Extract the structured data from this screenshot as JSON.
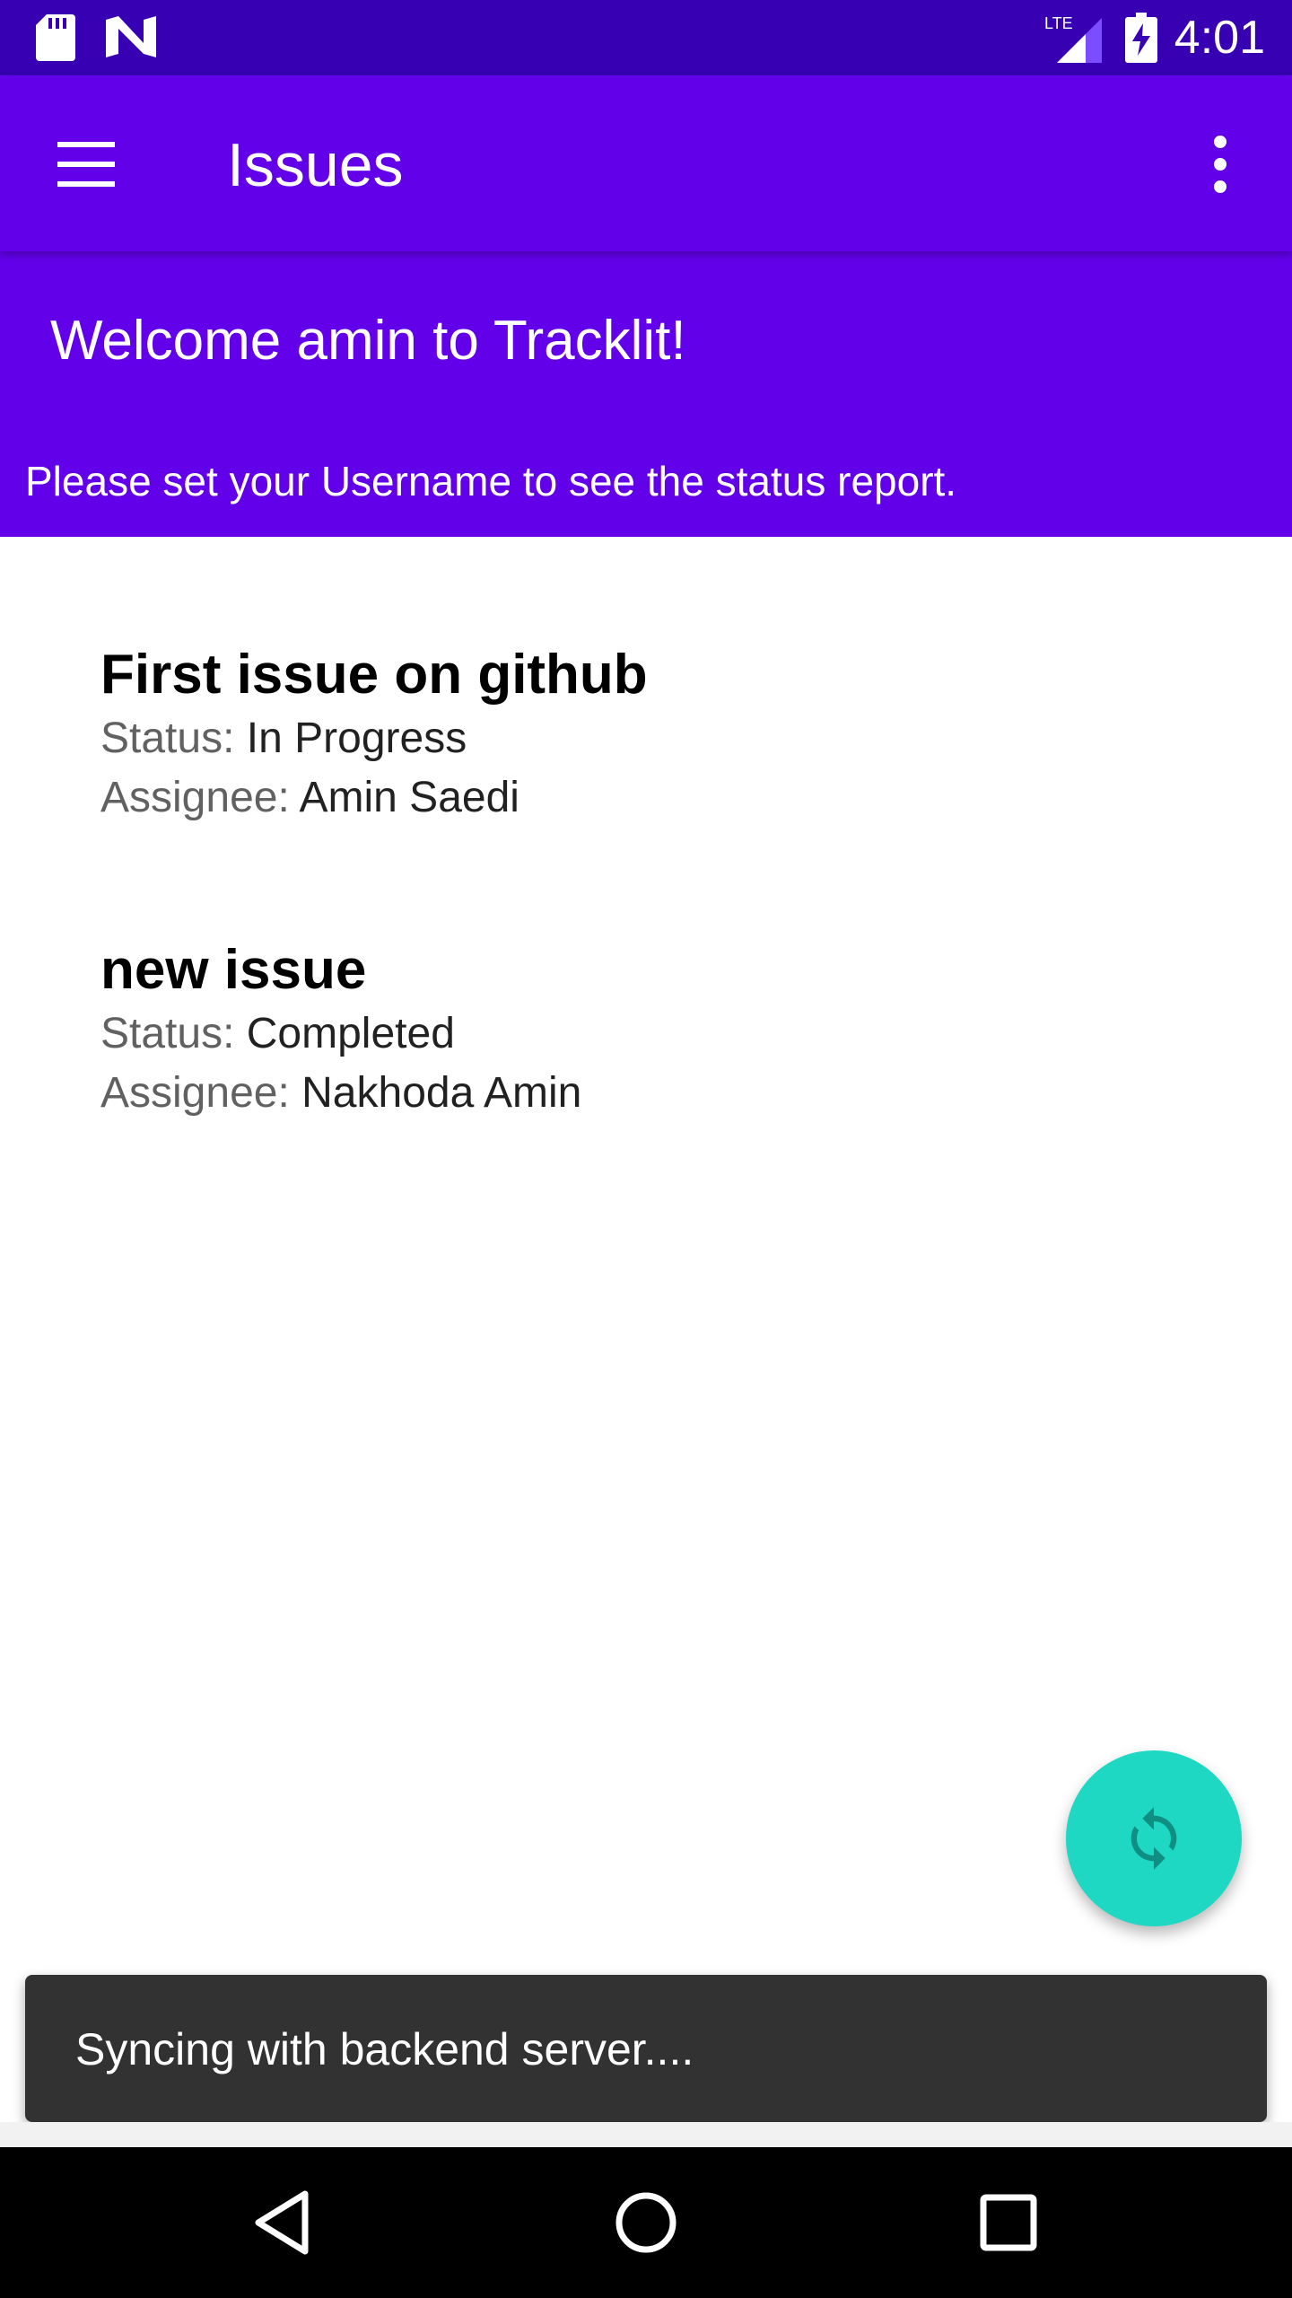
{
  "status_bar": {
    "time": "4:01",
    "network_label": "LTE",
    "icons": [
      "sd-card-icon",
      "n-notification-icon",
      "signal-icon",
      "battery-charging-icon"
    ]
  },
  "app_bar": {
    "title": "Issues",
    "icons": [
      "menu-icon",
      "more-vert-icon"
    ]
  },
  "banner": {
    "welcome": "Welcome amin to Tracklit!",
    "notice": "Please set your Username to see the status report."
  },
  "issues": [
    {
      "title": "First issue on github",
      "status_label": "Status:",
      "status": "In Progress",
      "assignee_label": "Assignee:",
      "assignee": "Amin Saedi"
    },
    {
      "title": "new issue",
      "status_label": "Status:",
      "status": "Completed",
      "assignee_label": "Assignee:",
      "assignee": "Nakhoda Amin"
    }
  ],
  "fab": {
    "icon": "sync-icon"
  },
  "snackbar": {
    "message": "Syncing with backend server...."
  },
  "nav_bar": {
    "icons": [
      "back-icon",
      "home-icon",
      "recents-icon"
    ]
  },
  "colors": {
    "status_bar": "#3700b3",
    "primary": "#6200ea",
    "fab": "#1ed8c4",
    "snackbar": "#323232"
  }
}
